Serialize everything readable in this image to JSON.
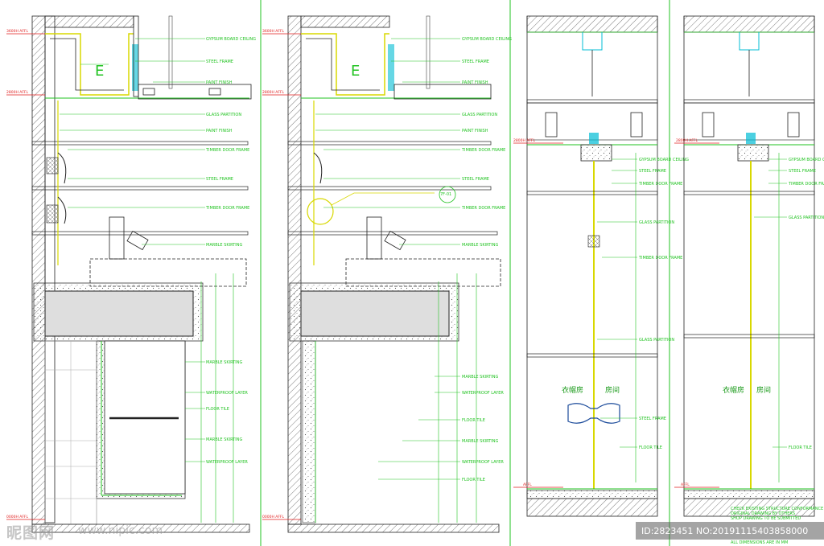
{
  "watermark": {
    "brand": "昵图网",
    "site": "www.nipic.com"
  },
  "image_id": "ID:28234​51 NO:20191115403858000",
  "colors": {
    "wall": "#222222",
    "dim": "#22c322",
    "detail": "#d8d800",
    "cyan": "#00bcd4",
    "level": "#e01e1e",
    "stone": "#555555"
  },
  "sections": [
    {
      "levels": [
        "3600H AFFL",
        "2800H AFFL",
        "0000H AFFL"
      ],
      "callout": "E"
    },
    {
      "levels": [
        "3600H AFFL",
        "2800H AFFL",
        "0000H AFFL"
      ],
      "callout": "E",
      "detail_ref": "7F-01"
    },
    {
      "levels": [
        "2800H AFFL",
        "AFFL"
      ],
      "rooms": [
        "衣帽房",
        "房间"
      ]
    },
    {
      "levels": [
        "2800H AFFL",
        "AFFL"
      ],
      "rooms": [
        "衣帽房",
        "房间"
      ]
    }
  ],
  "notes": [
    "GYPSUM BOARD CEILING",
    "STEEL FRAME",
    "PAINT FINISH",
    "GLASS PARTITION",
    "MARBLE SKIRTING",
    "TIMBER DOOR FRAME",
    "FLOOR TILE",
    "WATERPROOF LAYER"
  ],
  "stamp": [
    "CHECK EXISTING STRUCTURE CONFORMANCE",
    "ORIGINAL DRAWING BY OTHERS",
    "SHOP DRAWING TO BE SUBMITTED",
    "ALL DIMENSIONS ARE IN MM"
  ]
}
